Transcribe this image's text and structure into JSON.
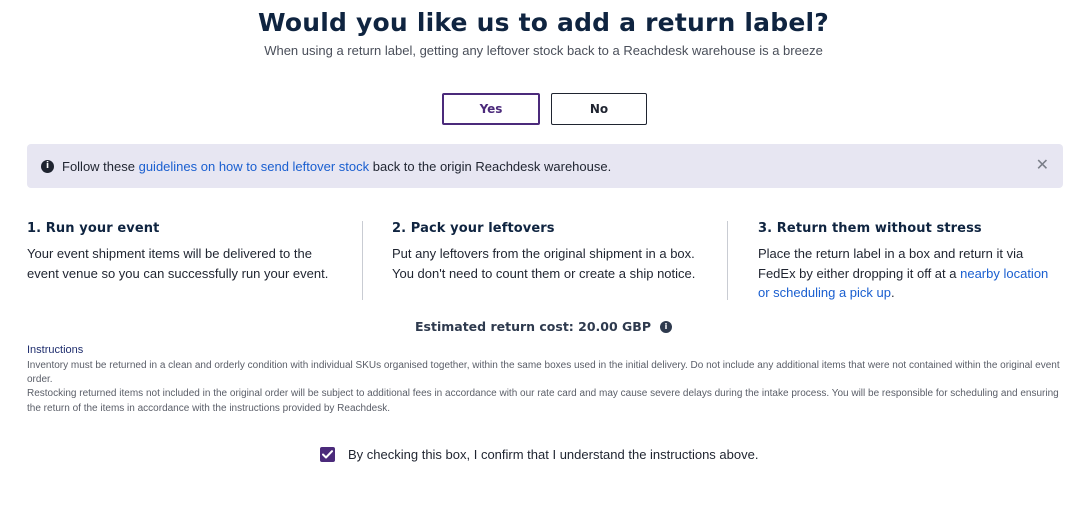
{
  "header": {
    "title": "Would you like us to add a return label?",
    "subtitle": "When using a return label, getting any leftover stock back to a Reachdesk warehouse is a breeze"
  },
  "choice": {
    "yes_label": "Yes",
    "no_label": "No",
    "selected": "Yes",
    "selected_color": "#4b2a7b"
  },
  "banner": {
    "icon": "info-icon",
    "prefix": "Follow these ",
    "link_text": "guidelines on how to send leftover stock",
    "suffix": " back to the origin Reachdesk warehouse.",
    "close_icon": "close-icon",
    "background": "#e7e6f2",
    "link_color": "#1a5fd0"
  },
  "steps": [
    {
      "title": "1. Run your event",
      "text": "Your event shipment items will be delivered to the event venue so you can successfully run your event."
    },
    {
      "title": "2. Pack your leftovers",
      "text": "Put any leftovers from the original shipment in a box. You don't need to count them or create a ship notice."
    },
    {
      "title": "3. Return them without stress",
      "text_prefix": "Place the return label in a box and return it via FedEx by either dropping it off at a ",
      "link_text": "nearby location or scheduling a pick up",
      "text_suffix": "."
    }
  ],
  "cost": {
    "label": "Estimated return cost: 20.00 GBP",
    "icon": "info-icon"
  },
  "instructions": {
    "title": "Instructions",
    "paragraph1": "Inventory must be returned in a clean and orderly condition with individual SKUs organised together, within the same boxes used in the initial delivery. Do not include any additional items that were not contained within the original event order.",
    "paragraph2": "Restocking returned items not included in the original order will be subject to additional fees in accordance with our rate card and may cause severe delays during the intake process. You will be responsible for scheduling and ensuring the return of the items in accordance with the instructions provided by Reachdesk."
  },
  "confirm": {
    "checked": true,
    "label": "By checking this box, I confirm that I understand the instructions above.",
    "color": "#4b2a7b"
  }
}
